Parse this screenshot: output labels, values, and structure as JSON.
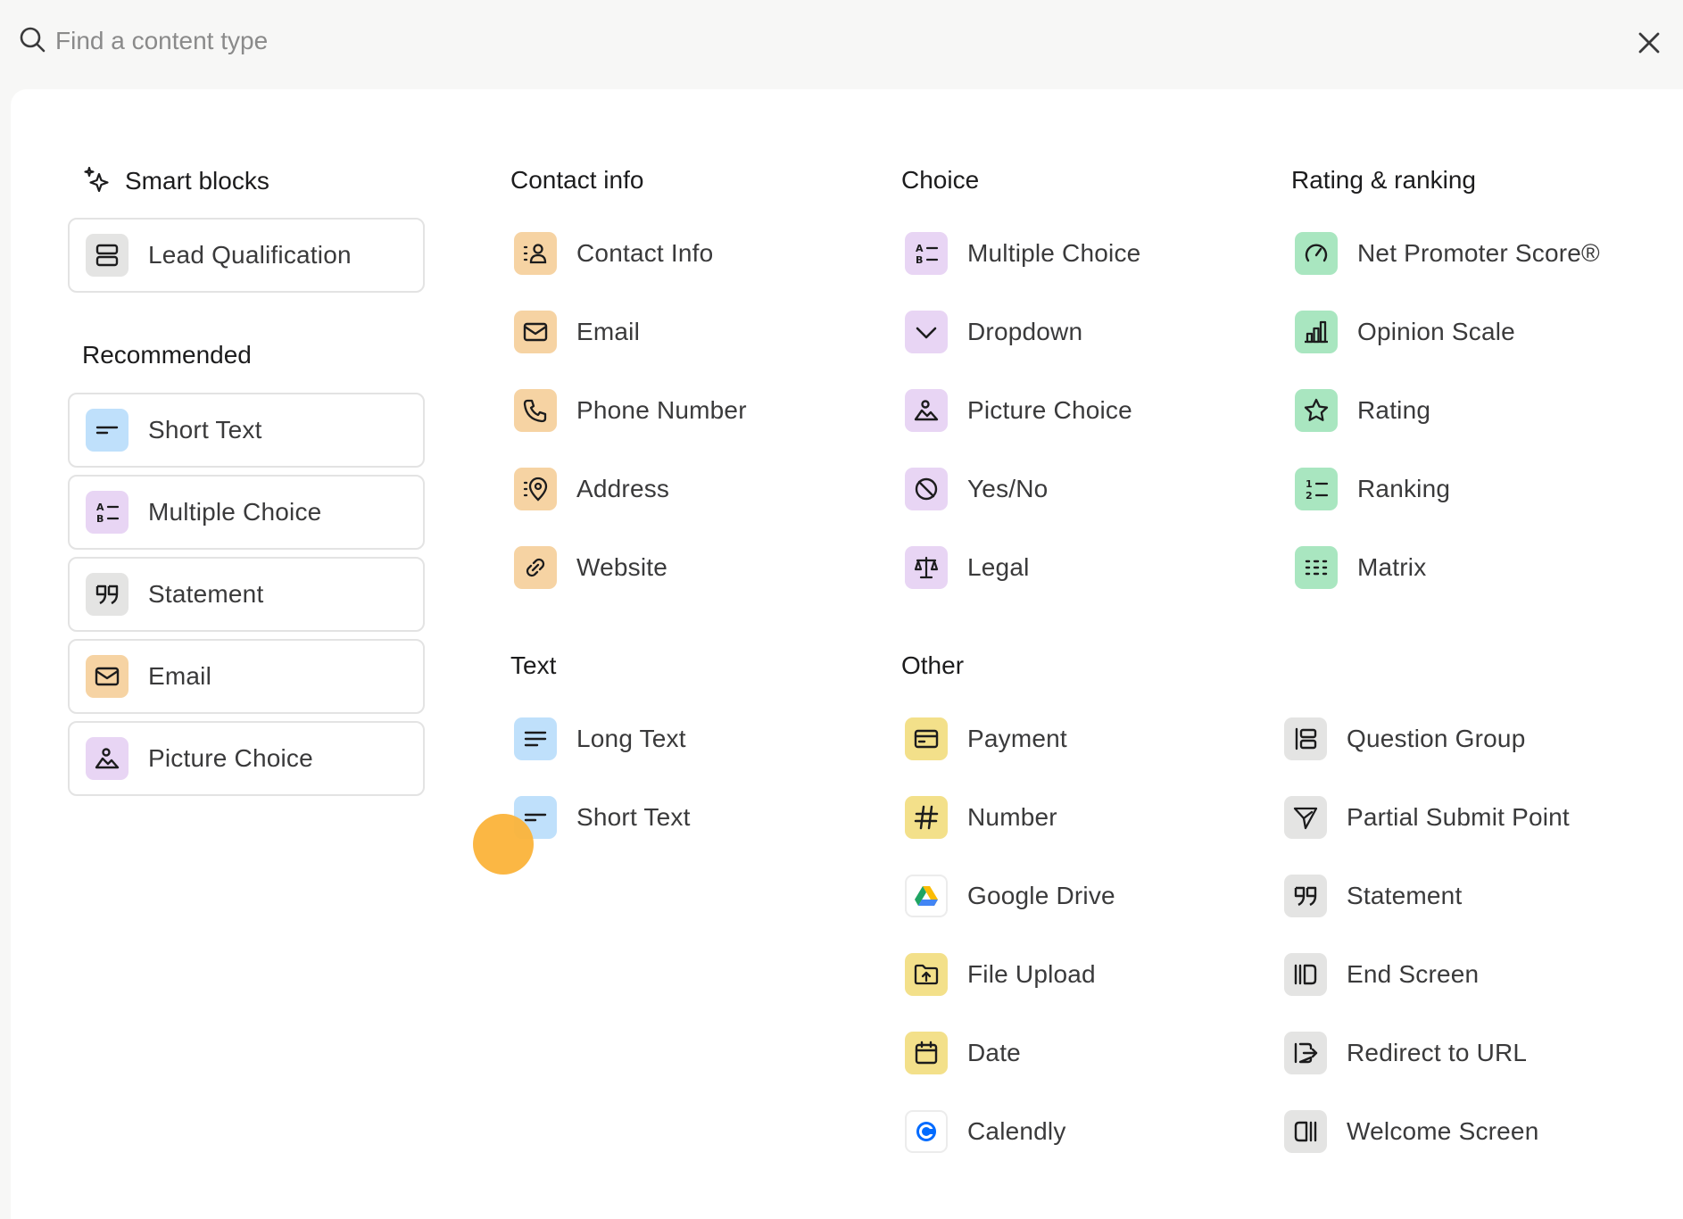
{
  "search": {
    "placeholder": "Find a content type",
    "value": ""
  },
  "sections": {
    "smart_blocks": {
      "title": "Smart blocks",
      "items": [
        {
          "label": "Lead Qualification"
        }
      ]
    },
    "recommended": {
      "title": "Recommended",
      "items": [
        {
          "label": "Short Text"
        },
        {
          "label": "Multiple Choice"
        },
        {
          "label": "Statement"
        },
        {
          "label": "Email"
        },
        {
          "label": "Picture Choice"
        }
      ]
    },
    "contact_info": {
      "title": "Contact info",
      "items": [
        {
          "label": "Contact Info"
        },
        {
          "label": "Email"
        },
        {
          "label": "Phone Number"
        },
        {
          "label": "Address"
        },
        {
          "label": "Website"
        }
      ]
    },
    "text": {
      "title": "Text",
      "items": [
        {
          "label": "Long Text"
        },
        {
          "label": "Short Text"
        }
      ]
    },
    "choice": {
      "title": "Choice",
      "items": [
        {
          "label": "Multiple Choice"
        },
        {
          "label": "Dropdown"
        },
        {
          "label": "Picture Choice"
        },
        {
          "label": "Yes/No"
        },
        {
          "label": "Legal"
        }
      ]
    },
    "other": {
      "title": "Other",
      "items": [
        {
          "label": "Payment"
        },
        {
          "label": "Number"
        },
        {
          "label": "Google Drive"
        },
        {
          "label": "File Upload"
        },
        {
          "label": "Date"
        },
        {
          "label": "Calendly"
        }
      ]
    },
    "rating_ranking": {
      "title": "Rating & ranking",
      "items": [
        {
          "label": "Net Promoter Score®"
        },
        {
          "label": "Opinion Scale"
        },
        {
          "label": "Rating"
        },
        {
          "label": "Ranking"
        },
        {
          "label": "Matrix"
        }
      ]
    },
    "other_right": {
      "items": [
        {
          "label": "Question Group"
        },
        {
          "label": "Partial Submit Point"
        },
        {
          "label": "Statement"
        },
        {
          "label": "End Screen"
        },
        {
          "label": "Redirect to URL"
        },
        {
          "label": "Welcome Screen"
        }
      ]
    }
  },
  "colors": {
    "gray": "#e4e4e3",
    "blue": "#bfe0fb",
    "purple": "#e8d5f4",
    "orange": "#f6d3a3",
    "green": "#a9e6c0",
    "yellow": "#f3e08a",
    "cursor": "#fbb33a"
  }
}
